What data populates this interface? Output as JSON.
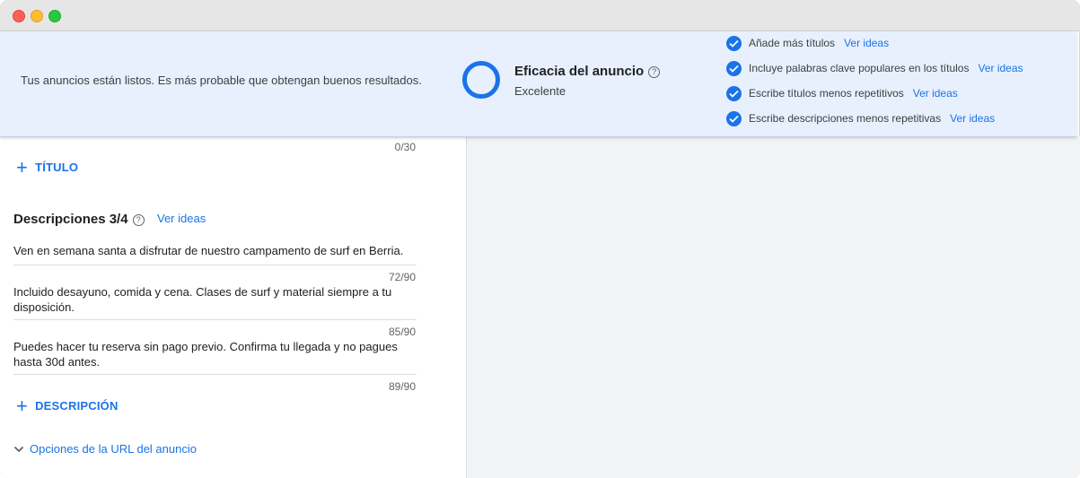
{
  "banner": {
    "message": "Tus anuncios están listos. Es más probable que obtengan buenos resultados.",
    "score_title": "Eficacia del anuncio",
    "score_value": "Excelente",
    "tips": [
      {
        "text": "Añade más títulos",
        "link": "Ver ideas"
      },
      {
        "text": "Incluye palabras clave populares en los títulos",
        "link": "Ver ideas"
      },
      {
        "text": "Escribe títulos menos repetitivos",
        "link": "Ver ideas"
      },
      {
        "text": "Escribe descripciones menos repetitivas",
        "link": "Ver ideas"
      }
    ]
  },
  "headlines": {
    "counter": "0/30",
    "add_label": "TÍTULO"
  },
  "descriptions": {
    "title": "Descripciones 3/4",
    "link": "Ver ideas",
    "items": [
      {
        "text": "Ven en semana santa a disfrutar de nuestro campamento de surf en Berria.",
        "counter": "72/90"
      },
      {
        "text": "Incluido desayuno, comida y cena. Clases de surf y material siempre a tu disposición.",
        "counter": "85/90"
      },
      {
        "text": "Puedes hacer tu reserva sin pago previo. Confirma tu llegada y no pagues hasta 30d antes.",
        "counter": "89/90"
      }
    ],
    "add_label": "DESCRIPCIÓN"
  },
  "url_options": {
    "label": "Opciones de la URL del anuncio"
  },
  "colors": {
    "accent": "#1a73e8",
    "banner_bg": "#e8f0fe"
  }
}
